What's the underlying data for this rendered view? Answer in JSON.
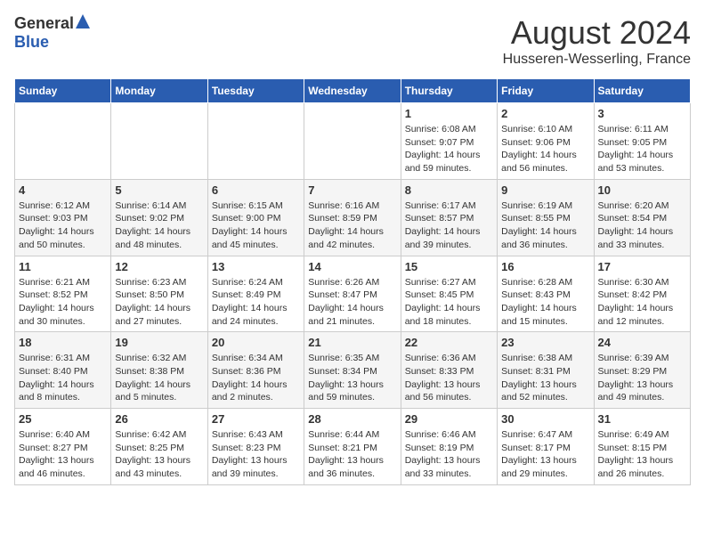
{
  "logo": {
    "general": "General",
    "blue": "Blue"
  },
  "header": {
    "month_year": "August 2024",
    "location": "Husseren-Wesserling, France"
  },
  "days_of_week": [
    "Sunday",
    "Monday",
    "Tuesday",
    "Wednesday",
    "Thursday",
    "Friday",
    "Saturday"
  ],
  "weeks": [
    [
      {
        "day": "",
        "info": ""
      },
      {
        "day": "",
        "info": ""
      },
      {
        "day": "",
        "info": ""
      },
      {
        "day": "",
        "info": ""
      },
      {
        "day": "1",
        "info": "Sunrise: 6:08 AM\nSunset: 9:07 PM\nDaylight: 14 hours and 59 minutes."
      },
      {
        "day": "2",
        "info": "Sunrise: 6:10 AM\nSunset: 9:06 PM\nDaylight: 14 hours and 56 minutes."
      },
      {
        "day": "3",
        "info": "Sunrise: 6:11 AM\nSunset: 9:05 PM\nDaylight: 14 hours and 53 minutes."
      }
    ],
    [
      {
        "day": "4",
        "info": "Sunrise: 6:12 AM\nSunset: 9:03 PM\nDaylight: 14 hours and 50 minutes."
      },
      {
        "day": "5",
        "info": "Sunrise: 6:14 AM\nSunset: 9:02 PM\nDaylight: 14 hours and 48 minutes."
      },
      {
        "day": "6",
        "info": "Sunrise: 6:15 AM\nSunset: 9:00 PM\nDaylight: 14 hours and 45 minutes."
      },
      {
        "day": "7",
        "info": "Sunrise: 6:16 AM\nSunset: 8:59 PM\nDaylight: 14 hours and 42 minutes."
      },
      {
        "day": "8",
        "info": "Sunrise: 6:17 AM\nSunset: 8:57 PM\nDaylight: 14 hours and 39 minutes."
      },
      {
        "day": "9",
        "info": "Sunrise: 6:19 AM\nSunset: 8:55 PM\nDaylight: 14 hours and 36 minutes."
      },
      {
        "day": "10",
        "info": "Sunrise: 6:20 AM\nSunset: 8:54 PM\nDaylight: 14 hours and 33 minutes."
      }
    ],
    [
      {
        "day": "11",
        "info": "Sunrise: 6:21 AM\nSunset: 8:52 PM\nDaylight: 14 hours and 30 minutes."
      },
      {
        "day": "12",
        "info": "Sunrise: 6:23 AM\nSunset: 8:50 PM\nDaylight: 14 hours and 27 minutes."
      },
      {
        "day": "13",
        "info": "Sunrise: 6:24 AM\nSunset: 8:49 PM\nDaylight: 14 hours and 24 minutes."
      },
      {
        "day": "14",
        "info": "Sunrise: 6:26 AM\nSunset: 8:47 PM\nDaylight: 14 hours and 21 minutes."
      },
      {
        "day": "15",
        "info": "Sunrise: 6:27 AM\nSunset: 8:45 PM\nDaylight: 14 hours and 18 minutes."
      },
      {
        "day": "16",
        "info": "Sunrise: 6:28 AM\nSunset: 8:43 PM\nDaylight: 14 hours and 15 minutes."
      },
      {
        "day": "17",
        "info": "Sunrise: 6:30 AM\nSunset: 8:42 PM\nDaylight: 14 hours and 12 minutes."
      }
    ],
    [
      {
        "day": "18",
        "info": "Sunrise: 6:31 AM\nSunset: 8:40 PM\nDaylight: 14 hours and 8 minutes."
      },
      {
        "day": "19",
        "info": "Sunrise: 6:32 AM\nSunset: 8:38 PM\nDaylight: 14 hours and 5 minutes."
      },
      {
        "day": "20",
        "info": "Sunrise: 6:34 AM\nSunset: 8:36 PM\nDaylight: 14 hours and 2 minutes."
      },
      {
        "day": "21",
        "info": "Sunrise: 6:35 AM\nSunset: 8:34 PM\nDaylight: 13 hours and 59 minutes."
      },
      {
        "day": "22",
        "info": "Sunrise: 6:36 AM\nSunset: 8:33 PM\nDaylight: 13 hours and 56 minutes."
      },
      {
        "day": "23",
        "info": "Sunrise: 6:38 AM\nSunset: 8:31 PM\nDaylight: 13 hours and 52 minutes."
      },
      {
        "day": "24",
        "info": "Sunrise: 6:39 AM\nSunset: 8:29 PM\nDaylight: 13 hours and 49 minutes."
      }
    ],
    [
      {
        "day": "25",
        "info": "Sunrise: 6:40 AM\nSunset: 8:27 PM\nDaylight: 13 hours and 46 minutes."
      },
      {
        "day": "26",
        "info": "Sunrise: 6:42 AM\nSunset: 8:25 PM\nDaylight: 13 hours and 43 minutes."
      },
      {
        "day": "27",
        "info": "Sunrise: 6:43 AM\nSunset: 8:23 PM\nDaylight: 13 hours and 39 minutes."
      },
      {
        "day": "28",
        "info": "Sunrise: 6:44 AM\nSunset: 8:21 PM\nDaylight: 13 hours and 36 minutes."
      },
      {
        "day": "29",
        "info": "Sunrise: 6:46 AM\nSunset: 8:19 PM\nDaylight: 13 hours and 33 minutes."
      },
      {
        "day": "30",
        "info": "Sunrise: 6:47 AM\nSunset: 8:17 PM\nDaylight: 13 hours and 29 minutes."
      },
      {
        "day": "31",
        "info": "Sunrise: 6:49 AM\nSunset: 8:15 PM\nDaylight: 13 hours and 26 minutes."
      }
    ]
  ]
}
